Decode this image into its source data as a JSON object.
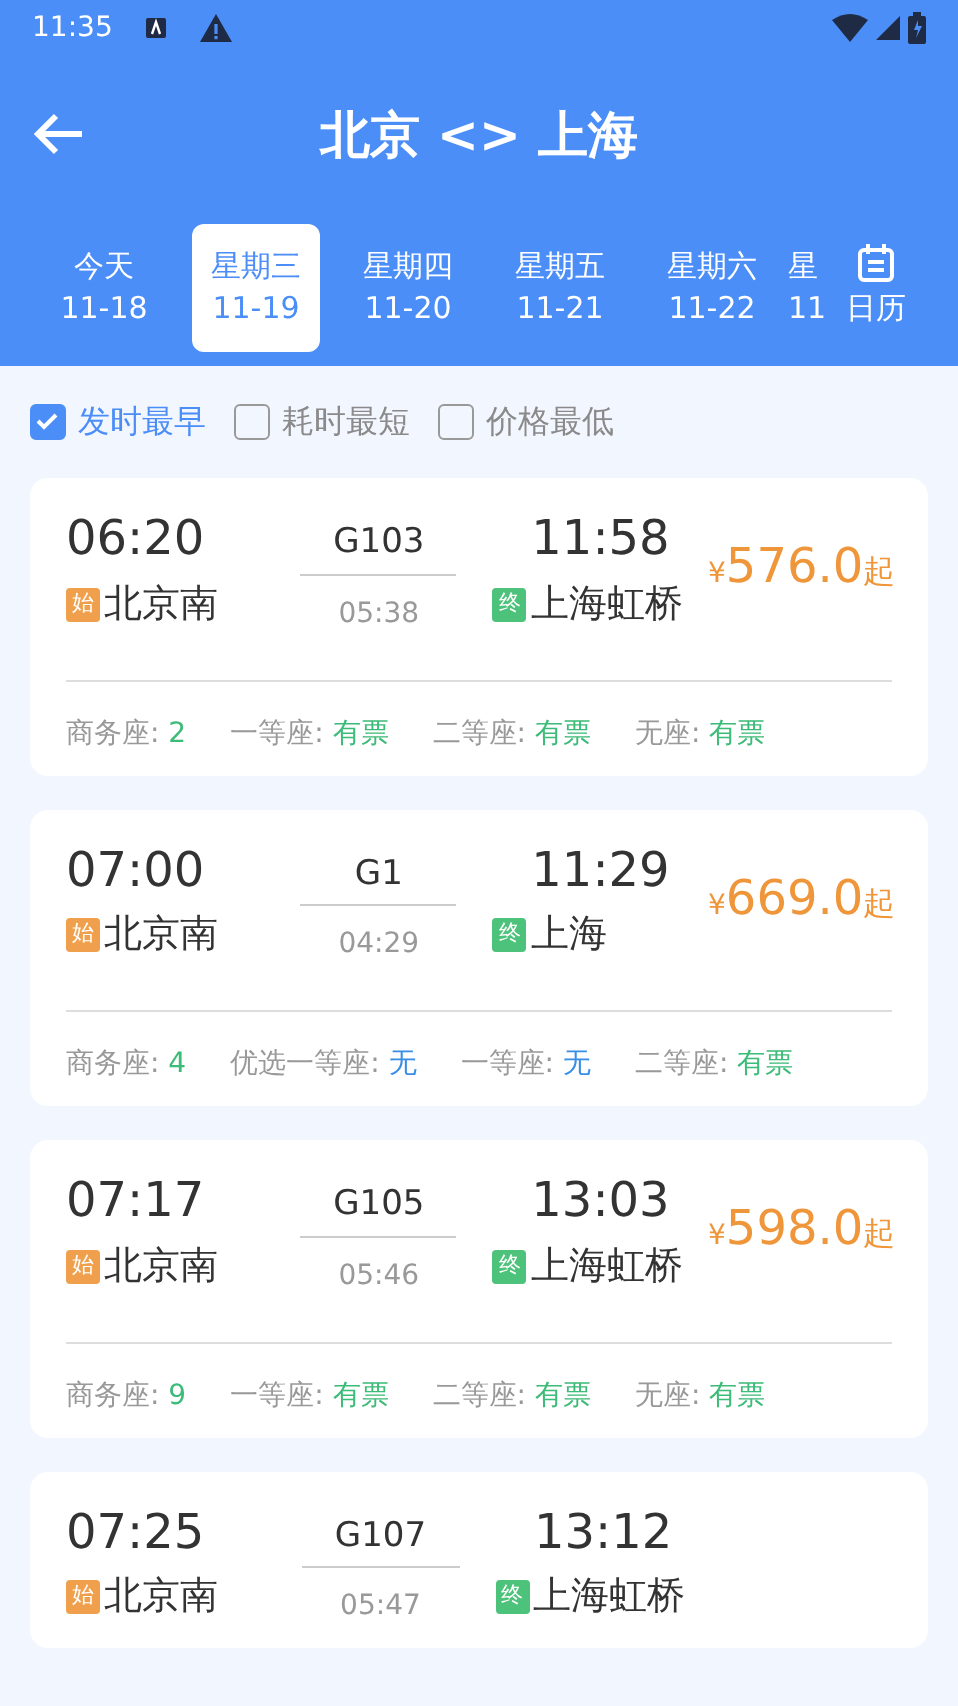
{
  "status_bar": {
    "time": "11:35"
  },
  "header": {
    "title": "北京 <> 上海"
  },
  "date_tabs": [
    {
      "day": "今天",
      "date": "11-18",
      "selected": false
    },
    {
      "day": "星期三",
      "date": "11-19",
      "selected": true
    },
    {
      "day": "星期四",
      "date": "11-20",
      "selected": false
    },
    {
      "day": "星期五",
      "date": "11-21",
      "selected": false
    },
    {
      "day": "星期六",
      "date": "11-22",
      "selected": false
    },
    {
      "day": "星",
      "date": "11",
      "selected": false
    }
  ],
  "calendar_button": {
    "label": "日历"
  },
  "sort_options": [
    {
      "label": "发时最早",
      "checked": true
    },
    {
      "label": "耗时最短",
      "checked": false
    },
    {
      "label": "价格最低",
      "checked": false
    }
  ],
  "trains": [
    {
      "depart": "06:20",
      "from_tag": "始",
      "from": "北京南",
      "number": "G103",
      "duration": "05:38",
      "arrive": "11:58",
      "to_tag": "终",
      "to": "上海虹桥",
      "currency": "¥",
      "price": "576.0",
      "price_suffix": "起",
      "seats": [
        {
          "name": "商务座:",
          "value": "2",
          "available": true
        },
        {
          "name": "一等座:",
          "value": "有票",
          "available": true
        },
        {
          "name": "二等座:",
          "value": "有票",
          "available": true
        },
        {
          "name": "无座:",
          "value": "有票",
          "available": true
        }
      ]
    },
    {
      "depart": "07:00",
      "from_tag": "始",
      "from": "北京南",
      "number": "G1",
      "duration": "04:29",
      "arrive": "11:29",
      "to_tag": "终",
      "to": "上海",
      "currency": "¥",
      "price": "669.0",
      "price_suffix": "起",
      "seats": [
        {
          "name": "商务座:",
          "value": "4",
          "available": true
        },
        {
          "name": "优选一等座:",
          "value": "无",
          "available": false
        },
        {
          "name": "一等座:",
          "value": "无",
          "available": false
        },
        {
          "name": "二等座:",
          "value": "有票",
          "available": true
        }
      ]
    },
    {
      "depart": "07:17",
      "from_tag": "始",
      "from": "北京南",
      "number": "G105",
      "duration": "05:46",
      "arrive": "13:03",
      "to_tag": "终",
      "to": "上海虹桥",
      "currency": "¥",
      "price": "598.0",
      "price_suffix": "起",
      "seats": [
        {
          "name": "商务座:",
          "value": "9",
          "available": true
        },
        {
          "name": "一等座:",
          "value": "有票",
          "available": true
        },
        {
          "name": "二等座:",
          "value": "有票",
          "available": true
        },
        {
          "name": "无座:",
          "value": "有票",
          "available": true
        }
      ]
    },
    {
      "depart": "07:25",
      "from_tag": "始",
      "from": "北京南",
      "number": "G107",
      "duration": "05:47",
      "arrive": "13:12",
      "to_tag": "终",
      "to": "上海虹桥"
    }
  ]
}
